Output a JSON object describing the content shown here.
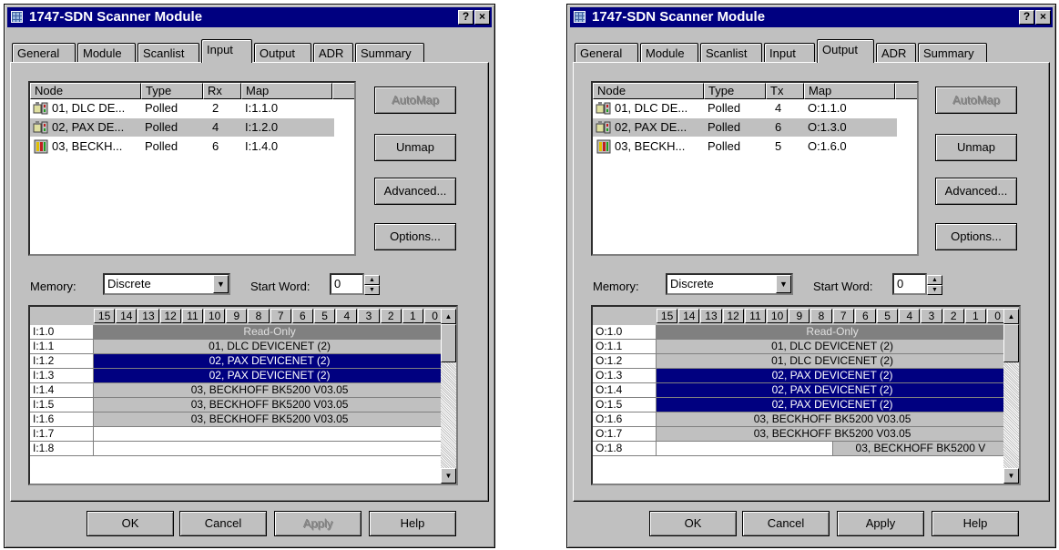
{
  "left": {
    "title": "1747-SDN Scanner Module",
    "help_btn": "?",
    "close_btn": "×",
    "tabs": [
      "General",
      "Module",
      "Scanlist",
      "Input",
      "Output",
      "ADR",
      "Summary"
    ],
    "active_tab": "Input",
    "columns": [
      "Node",
      "Type",
      "Rx",
      "Map"
    ],
    "rows": [
      {
        "node": "01, DLC DE...",
        "type": "Polled",
        "size": "2",
        "map": "I:1.1.0",
        "icon": "devicenet-node-icon"
      },
      {
        "node": "02, PAX DE...",
        "type": "Polled",
        "size": "4",
        "map": "I:1.2.0",
        "icon": "devicenet-node-icon"
      },
      {
        "node": "03, BECKH...",
        "type": "Polled",
        "size": "6",
        "map": "I:1.4.0",
        "icon": "beckhoff-node-icon"
      }
    ],
    "buttons": {
      "automap": "AutoMap",
      "unmap": "Unmap",
      "advanced": "Advanced...",
      "options": "Options..."
    },
    "memory_label": "Memory:",
    "memory_value": "Discrete",
    "start_word_label": "Start Word:",
    "start_word_value": "0",
    "bits": [
      "15",
      "14",
      "13",
      "12",
      "11",
      "10",
      "9",
      "8",
      "7",
      "6",
      "5",
      "4",
      "3",
      "2",
      "1",
      "0"
    ],
    "grid_rows": [
      {
        "addr": "I:1.0",
        "text": "Read-Only",
        "style": "ro"
      },
      {
        "addr": "I:1.1",
        "text": "01, DLC DEVICENET (2)",
        "style": "gray"
      },
      {
        "addr": "I:1.2",
        "text": "02, PAX DEVICENET (2)",
        "style": "navy"
      },
      {
        "addr": "I:1.3",
        "text": "02, PAX DEVICENET (2)",
        "style": "navy"
      },
      {
        "addr": "I:1.4",
        "text": "03, BECKHOFF BK5200 V03.05",
        "style": "gray"
      },
      {
        "addr": "I:1.5",
        "text": "03, BECKHOFF BK5200 V03.05",
        "style": "gray"
      },
      {
        "addr": "I:1.6",
        "text": "03, BECKHOFF BK5200 V03.05",
        "style": "gray"
      },
      {
        "addr": "I:1.7",
        "text": "",
        "style": "white"
      },
      {
        "addr": "I:1.8",
        "text": "",
        "style": "white"
      }
    ],
    "footer": {
      "ok": "OK",
      "cancel": "Cancel",
      "apply": "Apply",
      "help": "Help"
    }
  },
  "right": {
    "title": "1747-SDN Scanner Module",
    "help_btn": "?",
    "close_btn": "×",
    "tabs": [
      "General",
      "Module",
      "Scanlist",
      "Input",
      "Output",
      "ADR",
      "Summary"
    ],
    "active_tab": "Output",
    "columns": [
      "Node",
      "Type",
      "Tx",
      "Map"
    ],
    "rows": [
      {
        "node": "01, DLC DE...",
        "type": "Polled",
        "size": "4",
        "map": "O:1.1.0",
        "icon": "devicenet-node-icon"
      },
      {
        "node": "02, PAX DE...",
        "type": "Polled",
        "size": "6",
        "map": "O:1.3.0",
        "icon": "devicenet-node-icon"
      },
      {
        "node": "03, BECKH...",
        "type": "Polled",
        "size": "5",
        "map": "O:1.6.0",
        "icon": "beckhoff-node-icon"
      }
    ],
    "buttons": {
      "automap": "AutoMap",
      "unmap": "Unmap",
      "advanced": "Advanced...",
      "options": "Options..."
    },
    "memory_label": "Memory:",
    "memory_value": "Discrete",
    "start_word_label": "Start Word:",
    "start_word_value": "0",
    "bits": [
      "15",
      "14",
      "13",
      "12",
      "11",
      "10",
      "9",
      "8",
      "7",
      "6",
      "5",
      "4",
      "3",
      "2",
      "1",
      "0"
    ],
    "grid_rows": [
      {
        "addr": "O:1.0",
        "text": "Read-Only",
        "style": "ro"
      },
      {
        "addr": "O:1.1",
        "text": "01, DLC DEVICENET (2)",
        "style": "gray"
      },
      {
        "addr": "O:1.2",
        "text": "01, DLC DEVICENET (2)",
        "style": "gray"
      },
      {
        "addr": "O:1.3",
        "text": "02, PAX DEVICENET (2)",
        "style": "navy"
      },
      {
        "addr": "O:1.4",
        "text": "02, PAX DEVICENET (2)",
        "style": "navy"
      },
      {
        "addr": "O:1.5",
        "text": "02, PAX DEVICENET (2)",
        "style": "navy"
      },
      {
        "addr": "O:1.6",
        "text": "03, BECKHOFF BK5200 V03.05",
        "style": "gray"
      },
      {
        "addr": "O:1.7",
        "text": "03, BECKHOFF BK5200 V03.05",
        "style": "gray"
      },
      {
        "addr": "O:1.8",
        "text": "03, BECKHOFF BK5200 V",
        "style": "partial"
      }
    ],
    "footer": {
      "ok": "OK",
      "cancel": "Cancel",
      "apply": "Apply",
      "help": "Help"
    }
  }
}
